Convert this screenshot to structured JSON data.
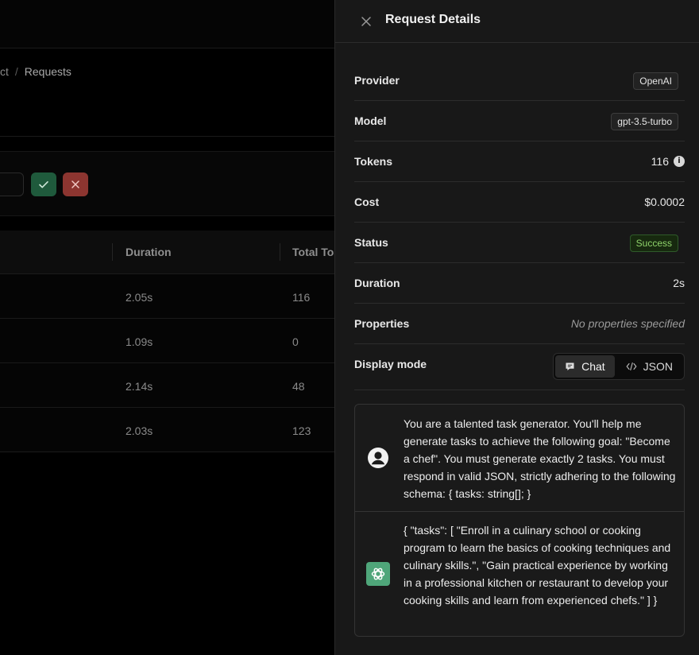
{
  "background": {
    "breadcrumb": {
      "parent": "ct",
      "separator": "/",
      "current": "Requests"
    },
    "table": {
      "headers": [
        "Duration",
        "Total To"
      ],
      "rows": [
        {
          "duration": "2.05s",
          "total_tokens": "116"
        },
        {
          "duration": "1.09s",
          "total_tokens": "0"
        },
        {
          "duration": "2.14s",
          "total_tokens": "48"
        },
        {
          "duration": "2.03s",
          "total_tokens": "123"
        }
      ]
    }
  },
  "drawer": {
    "title": "Request Details",
    "close_icon": "close-icon",
    "details": {
      "provider": {
        "label": "Provider",
        "value": "OpenAI"
      },
      "model": {
        "label": "Model",
        "value": "gpt-3.5-turbo"
      },
      "tokens": {
        "label": "Tokens",
        "value": "116"
      },
      "cost": {
        "label": "Cost",
        "value": "$0.0002"
      },
      "status": {
        "label": "Status",
        "value": "Success"
      },
      "duration": {
        "label": "Duration",
        "value": "2s"
      },
      "properties": {
        "label": "Properties",
        "value": "No properties specified"
      },
      "display_mode": {
        "label": "Display mode",
        "options": [
          "Chat",
          "JSON"
        ],
        "selected": "Chat"
      }
    },
    "messages": [
      {
        "role": "user",
        "text": "You are a talented task generator. You'll help me generate tasks to achieve the following goal: \"Become a chef\". You must generate exactly 2 tasks. You must respond in valid JSON, strictly adhering to the following schema: { tasks: string[]; }"
      },
      {
        "role": "assistant",
        "text": "{ \"tasks\": [ \"Enroll in a culinary school or cooking program to learn the basics of cooking techniques and culinary skills.\", \"Gain practical experience by working in a professional kitchen or restaurant to develop your cooking skills and learn from experienced chefs.\" ] }"
      }
    ]
  },
  "colors": {
    "success_text": "#8fd36a",
    "confirm_button": "#1f5a3c",
    "reject_button": "#8c3530",
    "assistant_avatar": "#4fa67a"
  }
}
